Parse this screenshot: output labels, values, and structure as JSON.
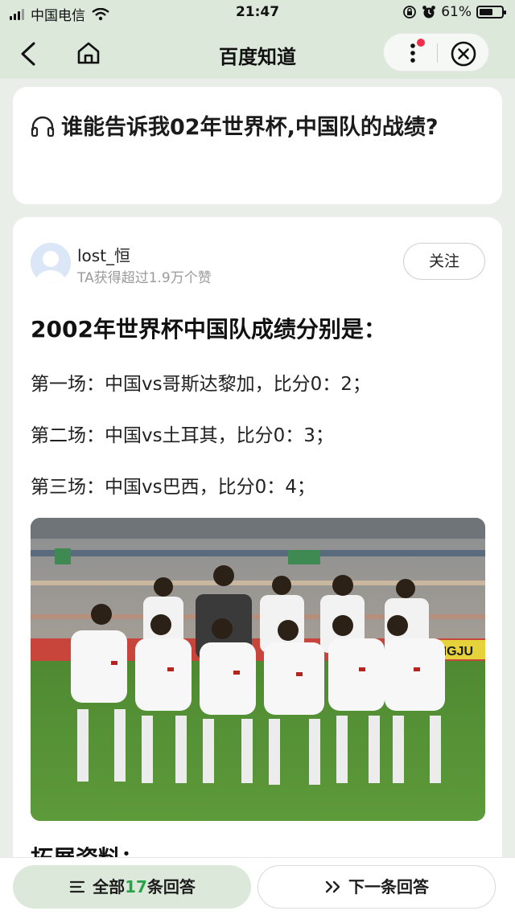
{
  "status_bar": {
    "carrier": "中国电信",
    "time": "21:47",
    "battery": "61%",
    "battery_level": 0.61,
    "icons": [
      "signal-icon",
      "wifi-icon",
      "lock-rotation-icon",
      "alarm-icon",
      "battery-icon"
    ]
  },
  "nav": {
    "title": "百度知道",
    "icons": [
      "back-icon",
      "home-icon",
      "more-icon",
      "close-icon"
    ],
    "notification_dot_color": "#f0304a"
  },
  "question": {
    "title": "谁能告诉我02年世界杯,中国队的战绩?",
    "icon": "headphones-icon"
  },
  "answer": {
    "author": {
      "name": "lost_恒",
      "meta": "TA获得超过1.9万个赞"
    },
    "follow_label": "关注",
    "headline": "2002年世界杯中国队成绩分别是：",
    "lines": [
      "第一场：中国vs哥斯达黎加，比分0：2；",
      "第二场：中国vs土耳其，比分0：3；",
      "第三场：中国vs巴西，比分0：4；"
    ],
    "photo": {
      "stadium_text": "ANGJU"
    },
    "subhead": "拓展资料："
  },
  "bottom": {
    "all_prefix": "全部",
    "all_count": "17",
    "all_suffix": "条回答",
    "next_label": "下一条回答",
    "accent_color": "#27a34a"
  }
}
